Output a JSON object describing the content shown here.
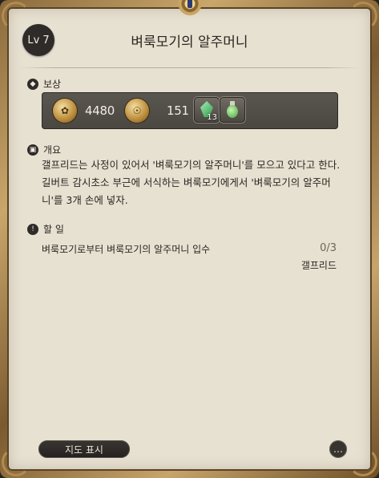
{
  "quest": {
    "level": "Lv 7",
    "title": "벼룩모기의 알주머니"
  },
  "reward": {
    "heading": "보상",
    "gil_amount": "4480",
    "seals_amount": "151",
    "item1_count": "13"
  },
  "summary": {
    "heading": "개요",
    "text": "갤프리드는 사정이 있어서 '벼룩모기의 알주머니'를 모으고 있다고 한다. 길버트 감시초소 부근에 서식하는 벼룩모기에게서 '벼룩모기의 알주머니'를 3개 손에 넣자."
  },
  "todo": {
    "heading": "할 일",
    "objective": "벼룩모기로부터 벼룩모기의 알주머니 입수",
    "progress": "0/3",
    "npc": "갤프리드"
  },
  "footer": {
    "map_button": "지도 표시"
  },
  "colors": {
    "parchment": "#e7e1d2",
    "frame_gold": "#c9a66a",
    "reward_bar": "#4a4640"
  }
}
